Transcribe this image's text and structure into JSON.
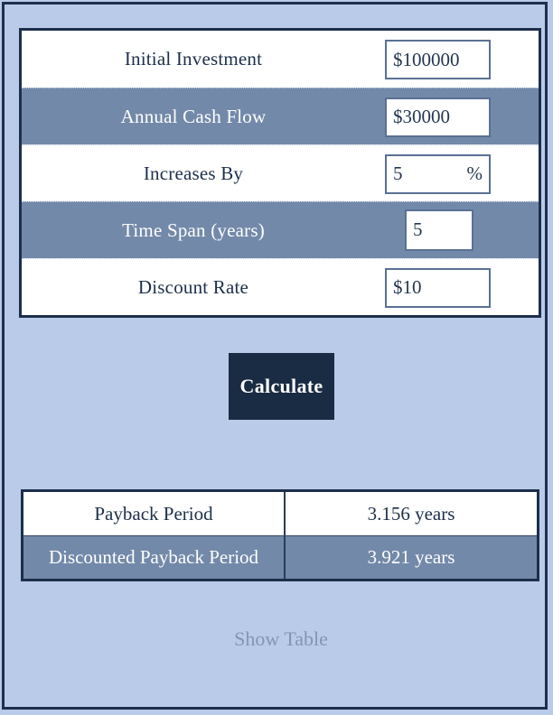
{
  "theme": {
    "page_background": "#b9cbe8",
    "frame_border": "#1d2f4a",
    "row_alt_background": "#7389a9",
    "text_dark": "#1d2f4a",
    "text_light": "#ffffff",
    "button_background": "#1a2c44",
    "link_color": "#8096b5",
    "field_border": "#5a7094"
  },
  "form": {
    "rows": [
      {
        "label": "Initial Investment",
        "value": "$100000",
        "unit": "",
        "field_style": "wide"
      },
      {
        "label": "Annual Cash Flow",
        "value": "$30000",
        "unit": "",
        "field_style": "wide"
      },
      {
        "label": "Increases By",
        "value": "5",
        "unit": "%",
        "field_style": "wide"
      },
      {
        "label": "Time Span (years)",
        "value": "5",
        "unit": "",
        "field_style": "narrow"
      },
      {
        "label": "Discount Rate",
        "value": "$10",
        "unit": "",
        "field_style": "wide"
      }
    ]
  },
  "actions": {
    "calculate_label": "Calculate",
    "show_table_label": "Show Table"
  },
  "results": {
    "rows": [
      {
        "label": "Payback Period",
        "value": "3.156 years"
      },
      {
        "label": "Discounted Payback Period",
        "value": "3.921 years"
      }
    ]
  }
}
